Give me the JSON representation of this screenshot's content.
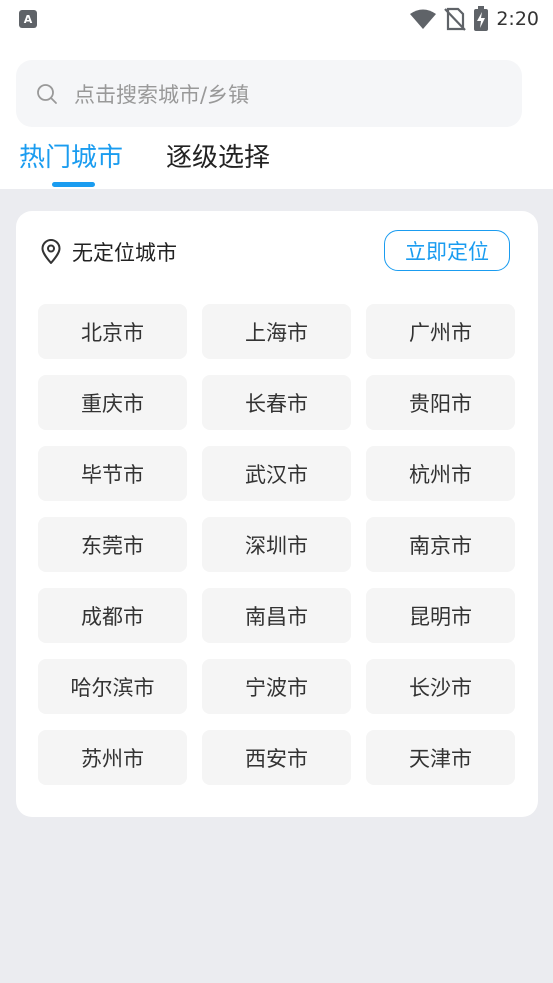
{
  "status_bar": {
    "left_icon": "A",
    "icons": [
      "wifi-icon",
      "no-sim-icon",
      "battery-charging-icon"
    ],
    "time": "2:20"
  },
  "search": {
    "placeholder": "点击搜索城市/乡镇",
    "value": ""
  },
  "tabs": [
    {
      "label": "热门城市",
      "active": true
    },
    {
      "label": "逐级选择",
      "active": false
    }
  ],
  "location": {
    "label": "无定位城市",
    "button_label": "立即定位"
  },
  "cities": [
    "北京市",
    "上海市",
    "广州市",
    "重庆市",
    "长春市",
    "贵阳市",
    "毕节市",
    "武汉市",
    "杭州市",
    "东莞市",
    "深圳市",
    "南京市",
    "成都市",
    "南昌市",
    "昆明市",
    "哈尔滨市",
    "宁波市",
    "长沙市",
    "苏州市",
    "西安市",
    "天津市"
  ],
  "colors": {
    "accent": "#1a9cf0",
    "background": "#ebecf0",
    "city_bg": "#f5f5f5"
  }
}
